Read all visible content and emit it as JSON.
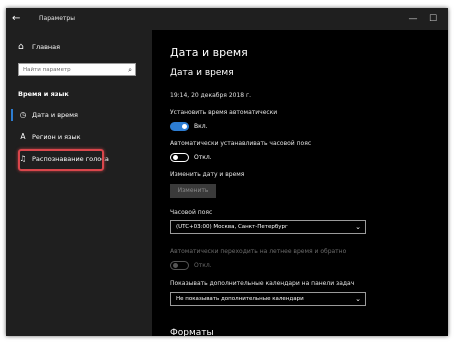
{
  "window": {
    "title": "Параметры",
    "back_glyph": "←",
    "minimize_glyph": "—",
    "maximize_glyph": "☐",
    "close_glyph": "✕"
  },
  "sidebar": {
    "home_label": "Главная",
    "search_placeholder": "Найти параметр",
    "section_title": "Время и язык",
    "items": [
      {
        "label": "Дата и время",
        "icon": "calendar-clock-icon",
        "glyph": "◷"
      },
      {
        "label": "Регион и язык",
        "icon": "language-icon",
        "glyph": "A"
      },
      {
        "label": "Распознавание голоса",
        "icon": "microphone-icon",
        "glyph": "♫"
      }
    ]
  },
  "main": {
    "page_title": "Дата и время",
    "section_title": "Дата и время",
    "current_time": "19:14, 20 декабря 2018 г.",
    "auto_time": {
      "label": "Установить время автоматически",
      "state": "Вкл.",
      "on": true
    },
    "auto_timezone": {
      "label": "Автоматически устанавливать часовой пояс",
      "state": "Откл.",
      "on": false
    },
    "change_datetime": {
      "label": "Изменить дату и время",
      "button": "Изменить"
    },
    "timezone": {
      "label": "Часовой пояс",
      "value": "(UTC+03:00) Москва, Санкт-Петербург"
    },
    "dst": {
      "label": "Автоматически переходить на летнее время и обратно",
      "state": "Откл.",
      "enabled": false
    },
    "extra_calendars": {
      "label": "Показывать дополнительные календари на панели задач",
      "value": "Не показывать дополнительные календари"
    },
    "formats_title": "Форматы"
  },
  "colors": {
    "accent": "#2d7dd2",
    "sidebar_bg": "#1f1f1f",
    "content_bg": "#000000",
    "highlight": "#d9464b"
  }
}
